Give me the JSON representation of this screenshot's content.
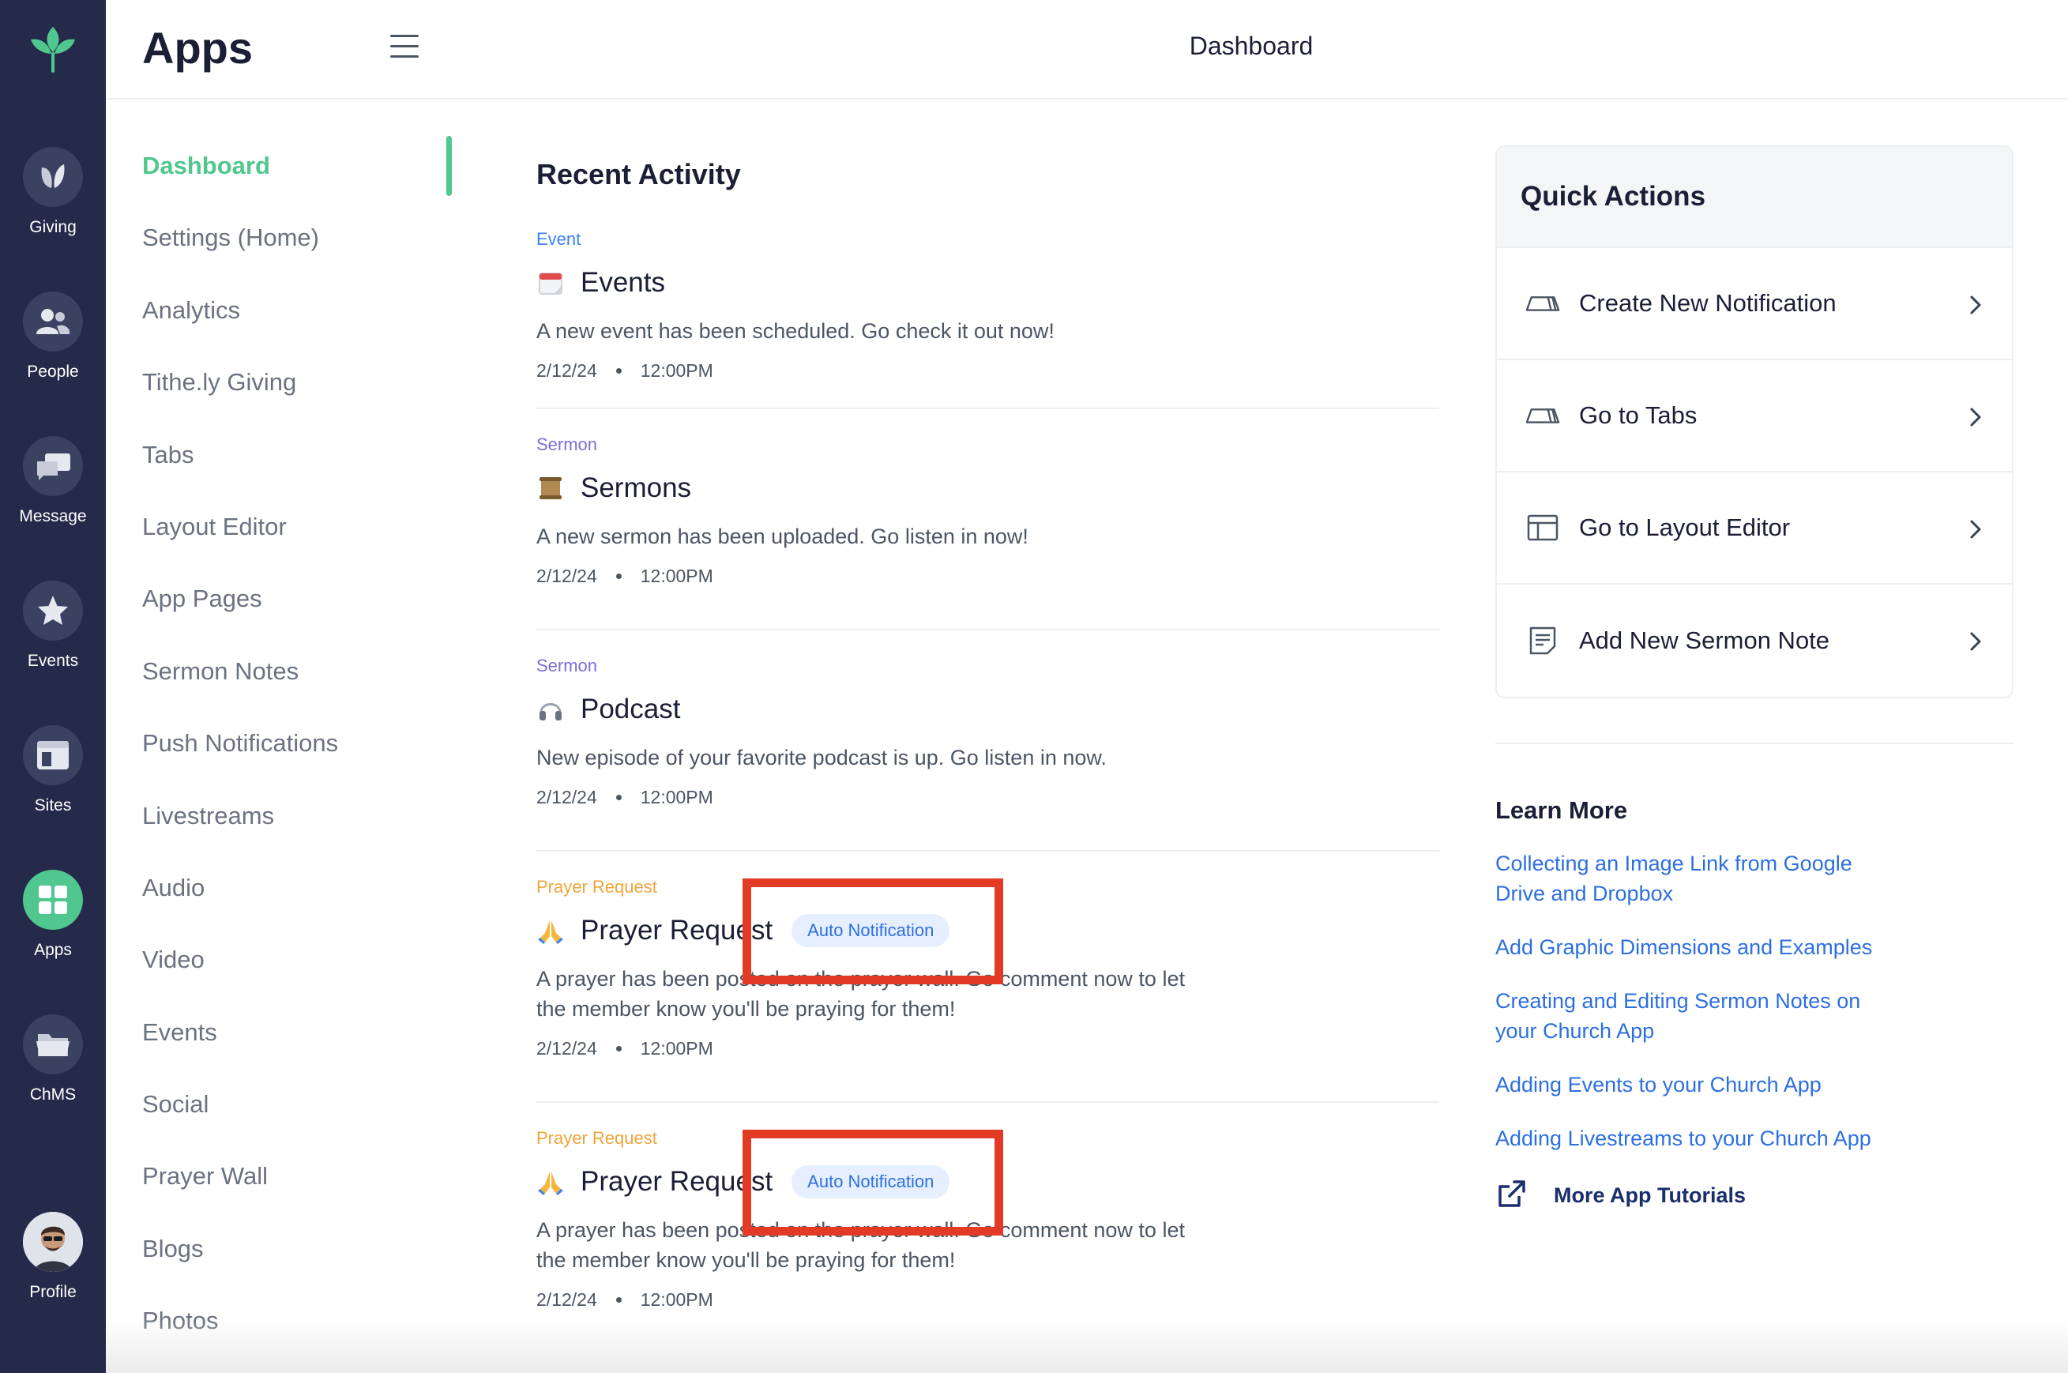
{
  "rail": {
    "items": [
      {
        "label": "Giving"
      },
      {
        "label": "People"
      },
      {
        "label": "Message"
      },
      {
        "label": "Events"
      },
      {
        "label": "Sites"
      },
      {
        "label": "Apps"
      },
      {
        "label": "ChMS"
      },
      {
        "label": "Profile"
      }
    ],
    "active_index": 5,
    "accent": "#4fc78f",
    "background": "#252a4a"
  },
  "sidebar": {
    "title": "Apps",
    "items": [
      {
        "label": "Dashboard"
      },
      {
        "label": "Settings (Home)"
      },
      {
        "label": "Analytics"
      },
      {
        "label": "Tithe.ly Giving"
      },
      {
        "label": "Tabs"
      },
      {
        "label": "Layout Editor"
      },
      {
        "label": "App Pages"
      },
      {
        "label": "Sermon Notes"
      },
      {
        "label": "Push Notifications"
      },
      {
        "label": "Livestreams"
      },
      {
        "label": "Audio"
      },
      {
        "label": "Video"
      },
      {
        "label": "Events"
      },
      {
        "label": "Social"
      },
      {
        "label": "Prayer Wall"
      },
      {
        "label": "Blogs"
      },
      {
        "label": "Photos"
      }
    ]
  },
  "header": {
    "title": "Dashboard"
  },
  "feed": {
    "title": "Recent Activity",
    "items": [
      {
        "tag": "Event",
        "tag_color": "#3b82f6",
        "icon": "calendar-icon",
        "name": "Events",
        "badge": "",
        "desc": "A new event has been scheduled. Go check it out now!",
        "date": "2/12/24",
        "time": "12:00PM"
      },
      {
        "tag": "Sermon",
        "tag_color": "#7c6fd6",
        "icon": "scroll-icon",
        "name": "Sermons",
        "badge": "",
        "desc": "A new sermon has been uploaded. Go listen in now!",
        "date": "2/12/24",
        "time": "12:00PM"
      },
      {
        "tag": "Sermon",
        "tag_color": "#7c6fd6",
        "icon": "headphones-icon",
        "name": "Podcast",
        "badge": "",
        "desc": "New episode of your favorite podcast is up. Go listen in now.",
        "date": "2/12/24",
        "time": "12:00PM"
      },
      {
        "tag": "Prayer Request",
        "tag_color": "#f0a43a",
        "icon": "praying-hands-icon",
        "name": "Prayer Request",
        "badge": "Auto Notification",
        "desc": "A prayer has been posted on the prayer wall. Go comment now to let the member know you'll be praying for them!",
        "date": "2/12/24",
        "time": "12:00PM"
      },
      {
        "tag": "Prayer Request",
        "tag_color": "#f0a43a",
        "icon": "praying-hands-icon",
        "name": "Prayer Request",
        "badge": "Auto Notification",
        "desc": "A prayer has been posted on the prayer wall. Go comment now to let the member know you'll be praying for them!",
        "date": "2/12/24",
        "time": "12:00PM"
      }
    ]
  },
  "quick_actions": {
    "title": "Quick Actions",
    "items": [
      {
        "label": "Create New Notification",
        "icon": "megaphone-icon"
      },
      {
        "label": "Go to Tabs",
        "icon": "megaphone-icon"
      },
      {
        "label": "Go to Layout Editor",
        "icon": "layout-icon"
      },
      {
        "label": "Add New Sermon Note",
        "icon": "note-icon"
      }
    ]
  },
  "learn_more": {
    "title": "Learn More",
    "links": [
      {
        "label": "Collecting an Image Link from Google Drive and Dropbox"
      },
      {
        "label": "Add Graphic Dimensions and Examples"
      },
      {
        "label": "Creating and Editing Sermon Notes on your Church App"
      },
      {
        "label": "Adding Events to your Church App"
      },
      {
        "label": "Adding Livestreams to your Church App"
      }
    ],
    "more_label": "More App Tutorials"
  },
  "colors": {
    "link": "#2c6fe0",
    "highlight_box": "#e23a24",
    "badge_bg": "#e6efff"
  }
}
